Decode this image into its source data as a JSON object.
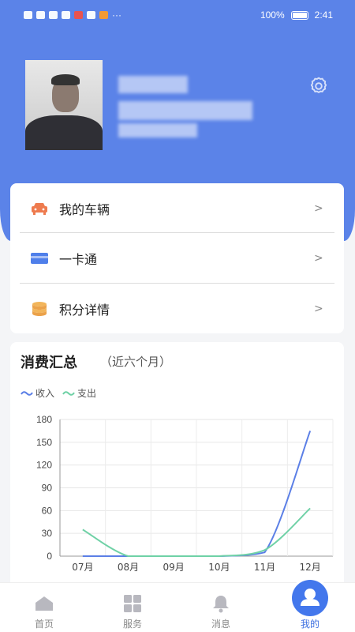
{
  "status_bar": {
    "battery": "100%",
    "time": "2:41"
  },
  "menu": {
    "items": [
      {
        "label": "我的车辆",
        "icon": "car-icon"
      },
      {
        "label": "一卡通",
        "icon": "card-icon"
      },
      {
        "label": "积分详情",
        "icon": "coins-icon"
      }
    ]
  },
  "summary": {
    "title": "消费汇总",
    "subtitle": "（近六个月）"
  },
  "chart_data": {
    "type": "line",
    "categories": [
      "07月",
      "08月",
      "09月",
      "10月",
      "11月",
      "12月"
    ],
    "series": [
      {
        "name": "收入",
        "color": "#5b7fe6",
        "values": [
          0,
          0,
          0,
          0,
          5,
          165
        ]
      },
      {
        "name": "支出",
        "color": "#6fd1a6",
        "values": [
          35,
          0,
          0,
          0,
          8,
          63
        ]
      }
    ],
    "ylim": [
      0,
      180
    ],
    "yticks": [
      0,
      30,
      60,
      90,
      120,
      150,
      180
    ],
    "grid": true,
    "legend": "top-left"
  },
  "tabbar": {
    "tabs": [
      {
        "label": "首页",
        "icon": "home-icon"
      },
      {
        "label": "服务",
        "icon": "grid-icon"
      },
      {
        "label": "消息",
        "icon": "bell-icon"
      },
      {
        "label": "我的",
        "icon": "user-icon"
      }
    ],
    "active": 3
  },
  "colors": {
    "primary": "#5b83e8",
    "active_tab": "#3d6fe0"
  }
}
